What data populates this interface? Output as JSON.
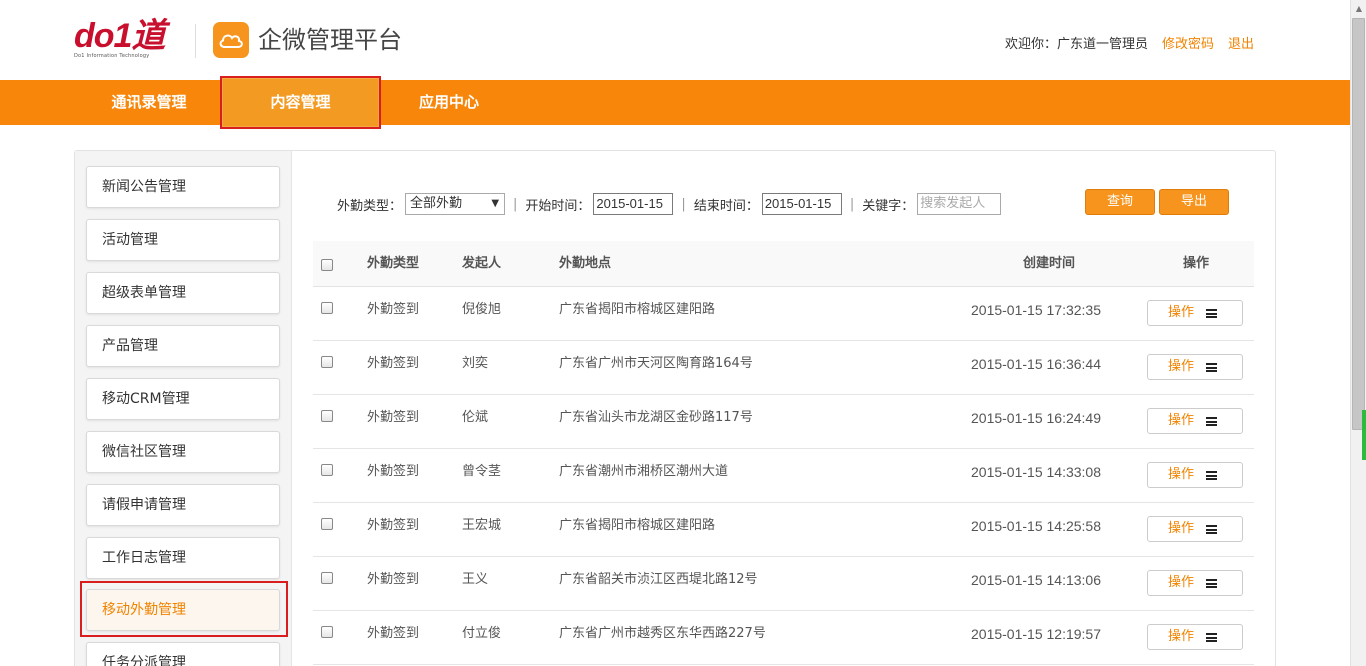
{
  "header": {
    "brand": "do1道",
    "brand_sub": "Do1 Information Technology",
    "app_title": "企微管理平台",
    "welcome": "欢迎你：广东道一管理员",
    "change_password": "修改密码",
    "logout": "退出"
  },
  "nav": {
    "items": [
      {
        "label": "通讯录管理"
      },
      {
        "label": "内容管理"
      },
      {
        "label": "应用中心"
      }
    ],
    "active_index": 1
  },
  "sidebar": {
    "items": [
      {
        "label": "新闻公告管理"
      },
      {
        "label": "活动管理"
      },
      {
        "label": "超级表单管理"
      },
      {
        "label": "产品管理"
      },
      {
        "label": "移动CRM管理"
      },
      {
        "label": "微信社区管理"
      },
      {
        "label": "请假申请管理"
      },
      {
        "label": "工作日志管理"
      },
      {
        "label": "移动外勤管理"
      },
      {
        "label": "任务分派管理"
      }
    ],
    "active_index": 8
  },
  "filter": {
    "type_label": "外勤类型：",
    "type_value": "全部外勤",
    "start_label": "开始时间：",
    "start_value": "2015-01-15",
    "end_label": "结束时间：",
    "end_value": "2015-01-15",
    "keyword_label": "关键字：",
    "keyword_placeholder": "搜索发起人",
    "query_button": "查询",
    "export_button": "导出"
  },
  "table": {
    "headers": {
      "type": "外勤类型",
      "initiator": "发起人",
      "location": "外勤地点",
      "created": "创建时间",
      "action": "操作"
    },
    "action_label": "操作",
    "rows": [
      {
        "type": "外勤签到",
        "initiator": "倪俊旭",
        "location": "广东省揭阳市榕城区建阳路",
        "created": "2015-01-15 17:32:35"
      },
      {
        "type": "外勤签到",
        "initiator": "刘奕",
        "location": "广东省广州市天河区陶育路164号",
        "created": "2015-01-15 16:36:44"
      },
      {
        "type": "外勤签到",
        "initiator": "伦斌",
        "location": "广东省汕头市龙湖区金砂路117号",
        "created": "2015-01-15 16:24:49"
      },
      {
        "type": "外勤签到",
        "initiator": "曾令茎",
        "location": "广东省潮州市湘桥区潮州大道",
        "created": "2015-01-15 14:33:08"
      },
      {
        "type": "外勤签到",
        "initiator": "王宏城",
        "location": "广东省揭阳市榕城区建阳路",
        "created": "2015-01-15 14:25:58"
      },
      {
        "type": "外勤签到",
        "initiator": "王义",
        "location": "广东省韶关市浈江区西堤北路12号",
        "created": "2015-01-15 14:13:06"
      },
      {
        "type": "外勤签到",
        "initiator": "付立俊",
        "location": "广东省广州市越秀区东华西路227号",
        "created": "2015-01-15 12:19:57"
      }
    ]
  },
  "colors": {
    "brand_orange": "#f7860a",
    "link_orange": "#f08300",
    "highlight_red": "#d81e1e"
  }
}
